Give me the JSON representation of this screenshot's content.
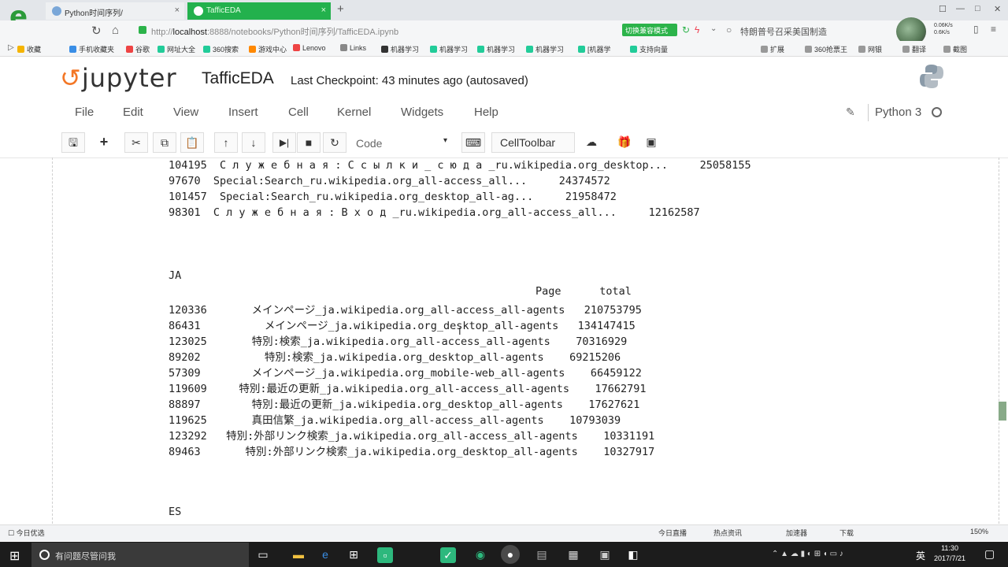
{
  "browser": {
    "tabs": [
      {
        "label": "Python时间序列/",
        "active": false
      },
      {
        "label": "TafficEDA",
        "active": true
      }
    ],
    "new_tab_label": "+",
    "url_prefix": "http://",
    "url_host": "localhost",
    "url_path": ":8888/notebooks/Python时间序列/TafficEDA.ipynb",
    "green_button_label": "切换兼容模式",
    "search_hint": "特朗普号召采美国制造",
    "speed_down": "0.06K/s",
    "speed_up": "0.6K/s",
    "bookmarks": [
      "收藏",
      "手机收藏夹",
      "谷歌",
      "网址大全",
      "360搜索",
      "游戏中心",
      "Lenovo",
      "Links",
      "机器学习",
      "机器学习",
      "机器学习",
      "机器学习",
      "[机器学",
      "支持向量"
    ],
    "bookmarks_right": [
      "扩展",
      "360抢票王",
      "网银",
      "翻译",
      "截图"
    ]
  },
  "jupyter": {
    "logo_text": "jupyter",
    "notebook_name": "TafficEDA",
    "checkpoint": "Last Checkpoint: 43 minutes ago (autosaved)",
    "menu": [
      "File",
      "Edit",
      "View",
      "Insert",
      "Cell",
      "Kernel",
      "Widgets",
      "Help"
    ],
    "kernel_name": "Python 3",
    "cell_type": "Code",
    "cell_toolbar_label": "CellToolbar"
  },
  "output": {
    "ru_tail": [
      "104195  С л у ж е б н а я : С с ы л к и _ с ю д а _ru.wikipedia.org_desktop...     25058155",
      "97670  Special:Search_ru.wikipedia.org_all-access_all...     24374572",
      "101457  Special:Search_ru.wikipedia.org_desktop_all-ag...     21958472",
      "98301  С л у ж е б н а я : В х о д _ru.wikipedia.org_all-access_all...     12162587"
    ],
    "ja_label": "JA",
    "ja_header": "Page      total",
    "ja_rows": [
      "120336       メインページ_ja.wikipedia.org_all-access_all-agents   210753795",
      "86431          メインページ_ja.wikipedia.org_desktop_all-agents   134147415",
      "123025       特別:検索_ja.wikipedia.org_all-access_all-agents    70316929",
      "89202          特別:検索_ja.wikipedia.org_desktop_all-agents    69215206",
      "57309        メインページ_ja.wikipedia.org_mobile-web_all-agents    66459122",
      "119609     特別:最近の更新_ja.wikipedia.org_all-access_all-agents    17662791",
      "88897        特別:最近の更新_ja.wikipedia.org_desktop_all-agents    17627621",
      "119625       真田信繁_ja.wikipedia.org_all-access_all-agents    10793039",
      "123292   特別:外部リンク検索_ja.wikipedia.org_all-access_all-agents    10331191",
      "89463       特別:外部リンク検索_ja.wikipedia.org_desktop_all-agents    10327917"
    ],
    "es_label": "ES"
  },
  "statusbar": {
    "left": "今日优选",
    "right": [
      "今日直播",
      "热点资讯",
      "加速器",
      "下载",
      "150%"
    ]
  },
  "taskbar": {
    "search_placeholder": "有问题尽管问我",
    "ime": "英",
    "time": "11:30",
    "date": "2017/7/21"
  }
}
